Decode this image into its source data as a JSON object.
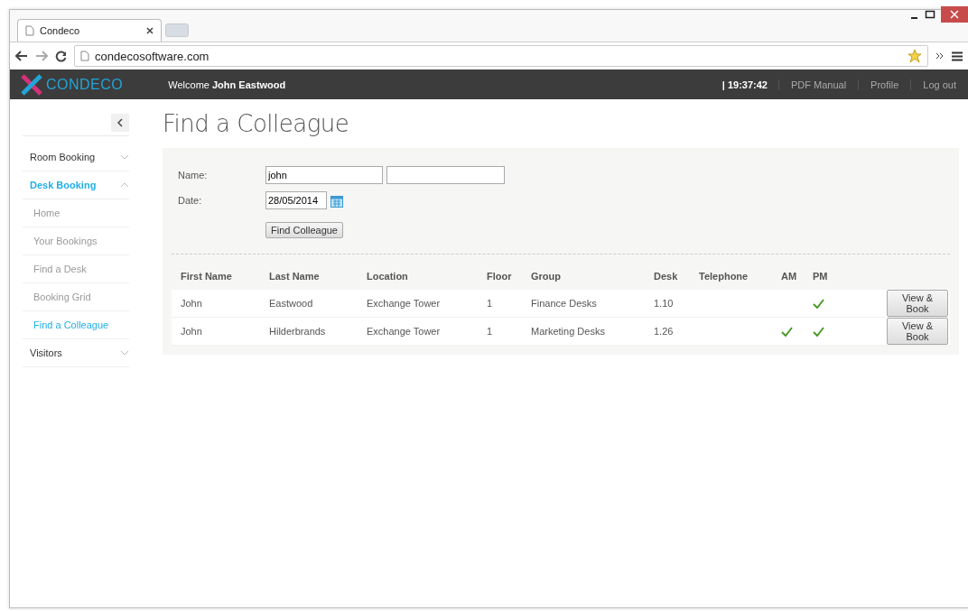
{
  "browser": {
    "tab_title": "Condeco",
    "url": "condecosoftware.com"
  },
  "header": {
    "logo": "CONDECO",
    "welcome": "Welcome",
    "user": "John Eastwood",
    "time": "| 19:37:42",
    "links": [
      "PDF Manual",
      "Profile",
      "Log out"
    ]
  },
  "sidebar": {
    "items": [
      {
        "kind": "section",
        "label": "Room Booking",
        "selected": false,
        "expanded": false
      },
      {
        "kind": "section",
        "label": "Desk Booking",
        "selected": true,
        "expanded": true,
        "children": [
          {
            "label": "Home",
            "selected": false
          },
          {
            "label": "Your Bookings",
            "selected": false
          },
          {
            "label": "Find a Desk",
            "selected": false
          },
          {
            "label": "Booking Grid",
            "selected": false
          },
          {
            "label": "Find a Colleague",
            "selected": true
          }
        ]
      },
      {
        "kind": "section",
        "label": "Visitors",
        "selected": false,
        "expanded": false
      }
    ]
  },
  "page": {
    "title": "Find a Colleague"
  },
  "form": {
    "name_label": "Name:",
    "first_name": "john",
    "date_label": "Date:",
    "date": "28/05/2014",
    "button": "Find Colleague"
  },
  "table": {
    "columns": [
      "First Name",
      "Last Name",
      "Location",
      "Floor",
      "Group",
      "Desk",
      "Telephone",
      "AM",
      "PM"
    ],
    "rows": [
      {
        "first_name": "John",
        "last_name": "Eastwood",
        "location": "Exchange Tower",
        "floor": "1",
        "group": "Finance Desks",
        "desk": "1.10",
        "am": false,
        "pm": true,
        "action": "View & Book"
      },
      {
        "first_name": "John",
        "last_name": "Hilderbrands",
        "location": "Exchange Tower",
        "floor": "1",
        "group": "Marketing Desks",
        "desk": "1.26",
        "am": true,
        "pm": true,
        "action": "View & Book"
      }
    ]
  }
}
